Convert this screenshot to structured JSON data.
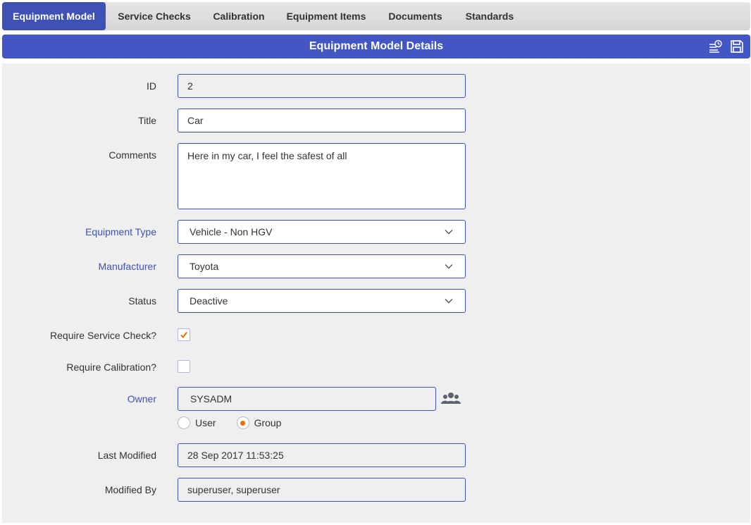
{
  "tabs": [
    {
      "label": "Equipment Model",
      "active": true
    },
    {
      "label": "Service Checks",
      "active": false
    },
    {
      "label": "Calibration",
      "active": false
    },
    {
      "label": "Equipment Items",
      "active": false
    },
    {
      "label": "Documents",
      "active": false
    },
    {
      "label": "Standards",
      "active": false
    }
  ],
  "header": {
    "title": "Equipment Model Details",
    "icons": [
      "history-list-icon",
      "save-icon"
    ]
  },
  "form": {
    "id": {
      "label": "ID",
      "value": "2"
    },
    "title": {
      "label": "Title",
      "value": "Car"
    },
    "comments": {
      "label": "Comments",
      "value": "Here in my car, I feel the safest of all"
    },
    "equipment_type": {
      "label": "Equipment Type",
      "value": "Vehicle - Non HGV"
    },
    "manufacturer": {
      "label": "Manufacturer",
      "value": "Toyota"
    },
    "status": {
      "label": "Status",
      "value": "Deactive"
    },
    "require_service_check": {
      "label": "Require Service Check?",
      "checked": true
    },
    "require_calibration": {
      "label": "Require Calibration?",
      "checked": false
    },
    "owner": {
      "label": "Owner",
      "value": "SYSADM",
      "options": [
        {
          "label": "User",
          "selected": false
        },
        {
          "label": "Group",
          "selected": true
        }
      ]
    },
    "last_modified": {
      "label": "Last Modified",
      "value": "28 Sep 2017 11:53:25"
    },
    "modified_by": {
      "label": "Modified By",
      "value": "superuser, superuser"
    }
  },
  "colors": {
    "accent": "#3f51b5",
    "header": "#4357c4",
    "check": "#ef6c00"
  }
}
